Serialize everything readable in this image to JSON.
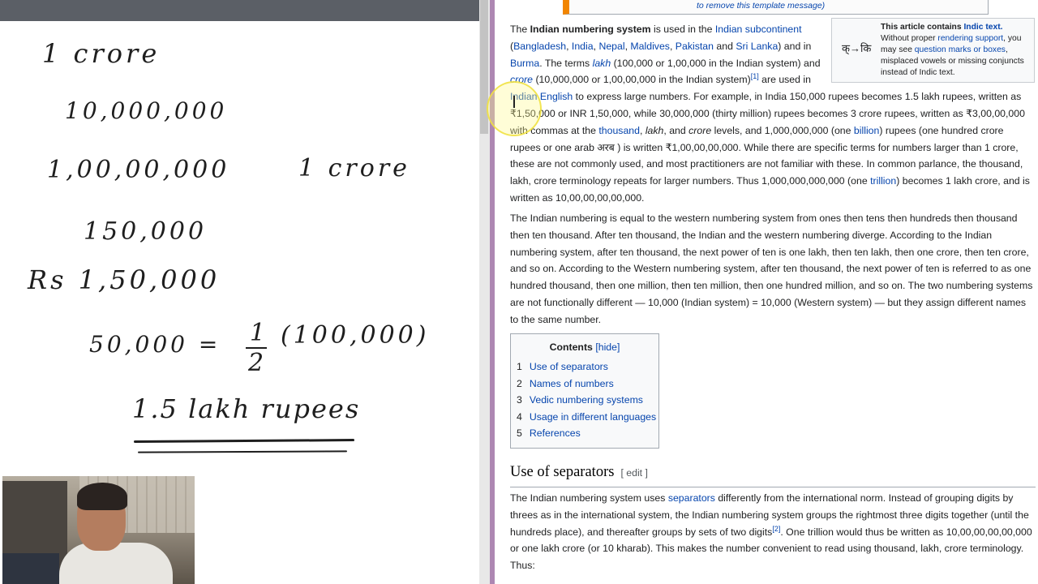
{
  "whiteboard": {
    "line1": "1 crore",
    "line2": "10,000,000",
    "line3": "1,00,00,000",
    "line3_note": "1 crore",
    "line4": "150,000",
    "line5": "Rs 1,50,000",
    "line6_left": "50,000 =",
    "line6_num": "1",
    "line6_den": "2",
    "line6_right": "(100,000)",
    "line7": "1.5 lakh rupees"
  },
  "webcam": {
    "icon": "presenter-video-icon"
  },
  "article": {
    "ambox_text": "to remove this template message)",
    "indic_box": {
      "icon_glyph": "क्→कि",
      "title_pre": "This article contains ",
      "title_link": "Indic text.",
      "body_1": " Without proper ",
      "link_1": "rendering support",
      "body_2": ", you may see ",
      "link_2": "question marks or boxes",
      "body_3": ", misplaced vowels or missing conjuncts instead of Indic text."
    },
    "p1": {
      "t1": "The ",
      "bold": "Indian numbering system",
      "t2": " is used in the ",
      "l_subcontinent": "Indian subcontinent",
      "t3": " (",
      "l_bangladesh": "Bangladesh",
      "t4": ", ",
      "l_india": "India",
      "t5": ", ",
      "l_nepal": "Nepal",
      "t6": ", ",
      "l_maldives": "Maldives",
      "t7": ", ",
      "l_pakistan": "Pakistan",
      "t8": " and ",
      "l_srilanka": "Sri Lanka",
      "t9": ") and in ",
      "l_burma": "Burma",
      "t10": ". The terms ",
      "l_lakh": "lakh",
      "t11": " (100,000 or 1,00,000 in the Indian system) and ",
      "l_crore": "crore",
      "t12": " (10,000,000 or 1,00,00,000 in the Indian system)",
      "ref1": "[1]",
      "t13": " are used in ",
      "l_indianenglish": "Indian English",
      "t14": " to express large numbers. For example, in India 150,000 rupees becomes 1.5 lakh rupees, written as ₹1,50,000 or INR 1,50,000, while 30,000,000 (thirty million) rupees becomes 3 crore rupees, written as ₹3,00,00,000 with commas at the ",
      "l_thousand": "thousand",
      "t15": ", ",
      "i_lakh": "lakh",
      "t16": ", and ",
      "i_crore": "crore",
      "t17": " levels, and 1,000,000,000 (one ",
      "l_billion": "billion",
      "t18": ") rupees (one hundred crore rupees or one arab अरब ) is written ₹1,00,00,00,000. While there are specific terms for numbers larger than 1 crore, these are not commonly used, and most practitioners are not familiar with these. In common parlance, the thousand, lakh, crore terminology repeats for larger numbers. Thus 1,000,000,000,000 (one ",
      "l_trillion": "trillion",
      "t19": ") becomes 1 lakh crore, and is written as 10,00,00,00,00,000."
    },
    "p2": "The Indian numbering is equal to the western numbering system from ones then tens then hundreds then thousand then ten thousand. After ten thousand, the Indian and the western numbering diverge. According to the Indian numbering system, after ten thousand, the next power of ten is one lakh, then ten lakh, then one crore, then ten crore, and so on. According to the Western numbering system, after ten thousand, the next power of ten is referred to as one hundred thousand, then one million, then ten million, then one hundred million, and so on. The two numbering systems are not functionally different — 10,000 (Indian system) = 10,000 (Western system) — but they assign different names to the same number.",
    "toc": {
      "title": "Contents",
      "hide_label": "[hide]",
      "items": [
        {
          "num": "1",
          "label": "Use of separators"
        },
        {
          "num": "2",
          "label": "Names of numbers"
        },
        {
          "num": "3",
          "label": "Vedic numbering systems"
        },
        {
          "num": "4",
          "label": "Usage in different languages"
        },
        {
          "num": "5",
          "label": "References"
        }
      ]
    },
    "section1": {
      "heading": "Use of separators",
      "edit_label": "[ edit ]"
    },
    "p3": {
      "t1": "The Indian numbering system uses ",
      "l_separators": "separators",
      "t2": " differently from the international norm. Instead of grouping digits by threes as in the international system, the Indian numbering system groups the rightmost three digits together (until the hundreds place), and thereafter groups by sets of two digits",
      "ref2": "[2]",
      "t3": ". One trillion would thus be written as 10,00,00,00,00,000 or one lakh crore (or 10 kharab). This makes the number convenient to read using thousand, lakh, crore terminology. Thus:"
    }
  }
}
